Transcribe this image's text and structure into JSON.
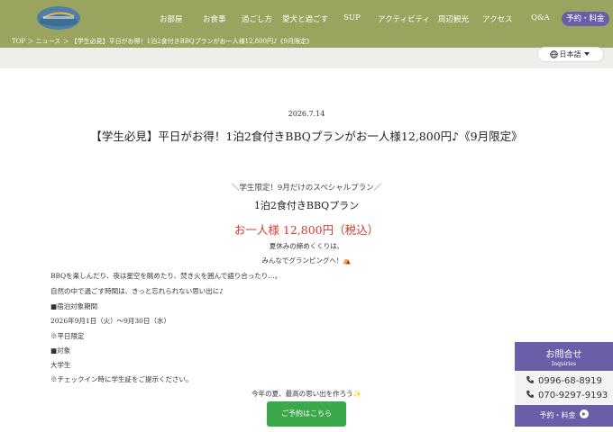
{
  "header": {
    "nav": [
      {
        "label": "お部屋"
      },
      {
        "label": "お食事"
      },
      {
        "label": "過ごし方"
      },
      {
        "label": "愛犬と過ごす"
      },
      {
        "label": "SUP"
      },
      {
        "label": "アクティビティ"
      },
      {
        "label": "周辺観光"
      },
      {
        "label": "アクセス"
      },
      {
        "label": "Q&A"
      }
    ],
    "cta_label": "予約・料金"
  },
  "breadcrumb": "TOP ＞ ニュース ＞ 【学生必見】平日がお得！1泊2食付きBBQプランがお一人様12,800円♪《9月限定》",
  "language": {
    "label": "日本語",
    "icon": "globe-icon"
  },
  "article": {
    "date": "2026.7.14",
    "title": "【学生必見】平日がお得！1泊2食付きBBQプランがお一人様12,800円♪《9月限定》",
    "subtitle": "＼学生限定！9月だけのスペシャルプラン／",
    "plan_name": "1泊2食付きBBQプラン",
    "price": "お一人様 12,800円（税込）",
    "intro_1": "夏休みの締めくくりは、",
    "intro_2": "みんなでグランピングへ！",
    "intro_2_emoji": "⛺",
    "body": [
      "BBQを楽しんだり、夜は星空を眺めたり、焚き火を囲んで語り合ったり…。",
      "自然の中で過ごす時間は、きっと忘れられない思い出に♪",
      "■宿泊対象期間",
      "2026年9月1日（火）〜9月30日（水）",
      "※平日限定",
      "■対象",
      "大学生",
      "※チェックイン時に学生証をご提示ください。"
    ],
    "closing": "今年の夏、最高の思い出を作ろう",
    "closing_emoji": "✨",
    "reserve_button": "ご予約はこちら"
  },
  "contact": {
    "title": "お問合せ",
    "subtitle": "Inquiries",
    "phone_1": "0996-68-8919",
    "phone_2": "070-9297-9193",
    "cta_label": "予約・料金"
  },
  "colors": {
    "header_olive": "#9aa45e",
    "accent_purple": "#6a5ea8",
    "price_red": "#d73a2f",
    "button_green": "#3aa84b"
  }
}
